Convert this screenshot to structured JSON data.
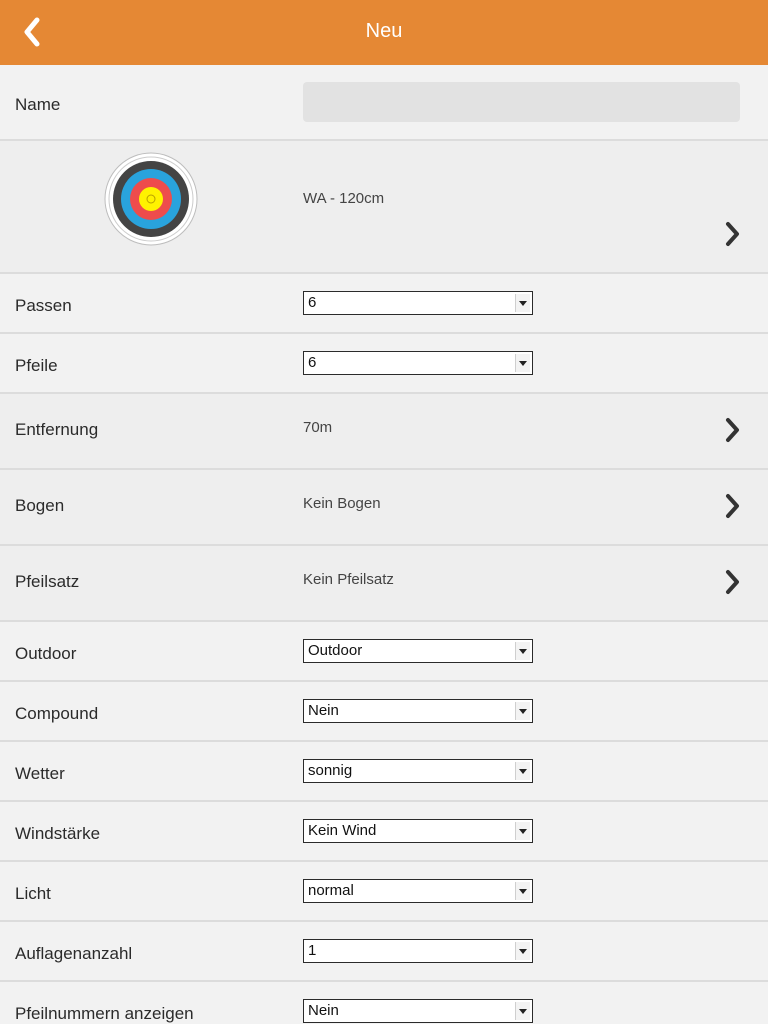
{
  "header": {
    "title": "Neu"
  },
  "rows": {
    "name": {
      "label": "Name",
      "value": ""
    },
    "target": {
      "value": "WA - 120cm"
    },
    "passen": {
      "label": "Passen",
      "value": "6"
    },
    "pfeile": {
      "label": "Pfeile",
      "value": "6"
    },
    "entfernung": {
      "label": "Entfernung",
      "value": "70m"
    },
    "bogen": {
      "label": "Bogen",
      "value": "Kein Bogen"
    },
    "pfeilsatz": {
      "label": "Pfeilsatz",
      "value": "Kein Pfeilsatz"
    },
    "outdoor": {
      "label": "Outdoor",
      "value": "Outdoor"
    },
    "compound": {
      "label": "Compound",
      "value": "Nein"
    },
    "wetter": {
      "label": "Wetter",
      "value": "sonnig"
    },
    "windstaerke": {
      "label": "Windstärke",
      "value": "Kein Wind"
    },
    "licht": {
      "label": "Licht",
      "value": "normal"
    },
    "auflagenanzahl": {
      "label": "Auflagenanzahl",
      "value": "1"
    },
    "pfeilnummern": {
      "label": "Pfeilnummern anzeigen",
      "value": "Nein"
    }
  },
  "colors": {
    "header": "#e58834",
    "target_rings": [
      "#ffffff",
      "#444444",
      "#29a3dd",
      "#ee4c4c",
      "#fff200"
    ]
  },
  "icons": {
    "back": "chevron-left-icon",
    "row_nav": "chevron-right-icon",
    "target": "archery-target-icon"
  }
}
